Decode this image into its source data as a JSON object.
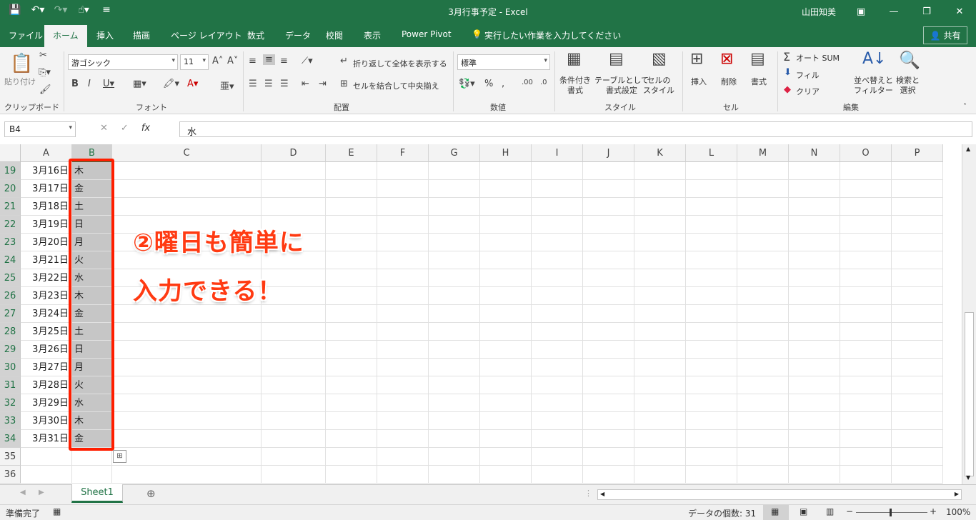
{
  "titlebar": {
    "title": "3月行事予定 - Excel",
    "user": "山田知美"
  },
  "tabs": [
    "ファイル",
    "ホーム",
    "挿入",
    "描画",
    "ページ レイアウト",
    "数式",
    "データ",
    "校閲",
    "表示",
    "Power Pivot"
  ],
  "tell_me": "実行したい作業を入力してください",
  "share_label": "共有",
  "ribbon": {
    "clipboard": {
      "paste": "貼り付け",
      "group": "クリップボード"
    },
    "font": {
      "name": "游ゴシック",
      "size": "11",
      "group": "フォント"
    },
    "alignment": {
      "wrap": "折り返して全体を表示する",
      "merge": "セルを結合して中央揃え",
      "group": "配置"
    },
    "number": {
      "format": "標準",
      "group": "数値"
    },
    "styles": {
      "conditional": "条件付き\n書式",
      "table": "テーブルとして\n書式設定",
      "cell": "セルの\nスタイル",
      "group": "スタイル"
    },
    "cells": {
      "insert": "挿入",
      "delete": "削除",
      "format": "書式",
      "group": "セル"
    },
    "editing": {
      "autosum": "オート SUM",
      "fill": "フィル",
      "clear": "クリア",
      "sort": "並べ替えと\nフィルター",
      "find": "検索と\n選択",
      "group": "編集"
    }
  },
  "formula_bar": {
    "name_box": "B4",
    "value": "水"
  },
  "columns": [
    "A",
    "B",
    "C",
    "D",
    "E",
    "F",
    "G",
    "H",
    "I",
    "J",
    "K",
    "L",
    "M",
    "N",
    "O",
    "P"
  ],
  "rows": [
    {
      "num": "19",
      "date": "3月16日",
      "day": "木"
    },
    {
      "num": "20",
      "date": "3月17日",
      "day": "金"
    },
    {
      "num": "21",
      "date": "3月18日",
      "day": "土"
    },
    {
      "num": "22",
      "date": "3月19日",
      "day": "日"
    },
    {
      "num": "23",
      "date": "3月20日",
      "day": "月"
    },
    {
      "num": "24",
      "date": "3月21日",
      "day": "火"
    },
    {
      "num": "25",
      "date": "3月22日",
      "day": "水"
    },
    {
      "num": "26",
      "date": "3月23日",
      "day": "木"
    },
    {
      "num": "27",
      "date": "3月24日",
      "day": "金"
    },
    {
      "num": "28",
      "date": "3月25日",
      "day": "土"
    },
    {
      "num": "29",
      "date": "3月26日",
      "day": "日"
    },
    {
      "num": "30",
      "date": "3月27日",
      "day": "月"
    },
    {
      "num": "31",
      "date": "3月28日",
      "day": "火"
    },
    {
      "num": "32",
      "date": "3月29日",
      "day": "水"
    },
    {
      "num": "33",
      "date": "3月30日",
      "day": "木"
    },
    {
      "num": "34",
      "date": "3月31日",
      "day": "金"
    },
    {
      "num": "35",
      "date": "",
      "day": ""
    },
    {
      "num": "36",
      "date": "",
      "day": ""
    }
  ],
  "annotation": {
    "line1": "②曜日も簡単に",
    "line2": "入力できる！"
  },
  "sheet_tab": "Sheet1",
  "status": {
    "ready": "準備完了",
    "count": "データの個数: 31",
    "zoom": "100%"
  }
}
